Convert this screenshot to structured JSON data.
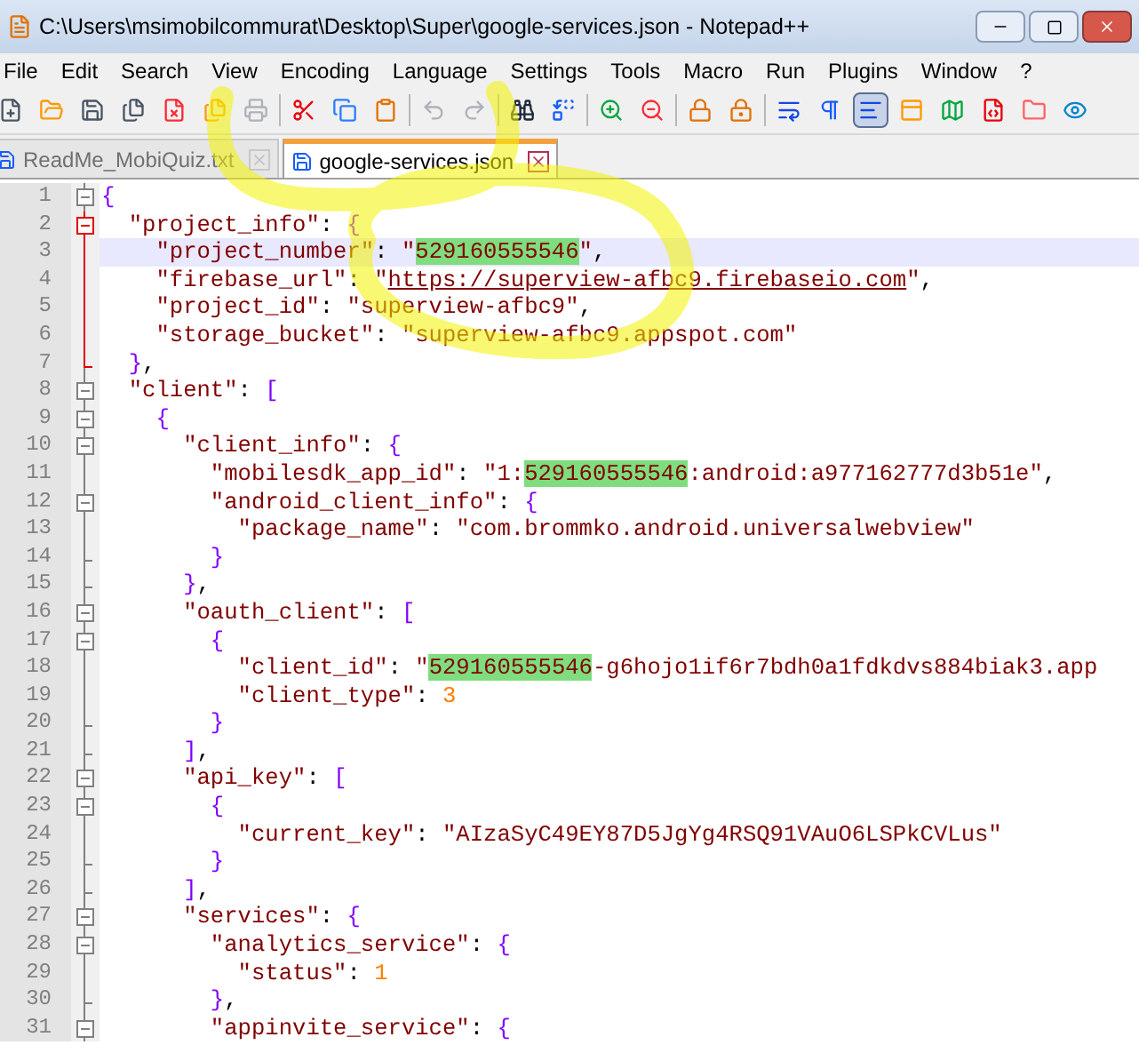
{
  "window": {
    "title": "C:\\Users\\msimobilcommurat\\Desktop\\Super\\google-services.json - Notepad++"
  },
  "menu": [
    "File",
    "Edit",
    "Search",
    "View",
    "Encoding",
    "Language",
    "Settings",
    "Tools",
    "Macro",
    "Run",
    "Plugins",
    "Window",
    "?"
  ],
  "toolbar": [
    {
      "pressed": false,
      "disabled": false
    },
    {
      "pressed": false,
      "disabled": false
    },
    {
      "pressed": false,
      "disabled": false
    },
    {
      "pressed": false,
      "disabled": false
    },
    {
      "pressed": false,
      "disabled": false
    },
    {
      "pressed": false,
      "disabled": false
    },
    {
      "pressed": false,
      "disabled": true
    },
    {
      "pressed": false,
      "disabled": false
    },
    {
      "pressed": false,
      "disabled": false
    },
    {
      "pressed": false,
      "disabled": false
    },
    {
      "pressed": false,
      "disabled": true
    },
    {
      "pressed": false,
      "disabled": true
    },
    {
      "pressed": false,
      "disabled": false
    },
    {
      "pressed": false,
      "disabled": false
    },
    {
      "pressed": false,
      "disabled": false
    },
    {
      "pressed": false,
      "disabled": false
    },
    {
      "pressed": false,
      "disabled": false
    },
    {
      "pressed": false,
      "disabled": false
    },
    {
      "pressed": false,
      "disabled": false
    },
    {
      "pressed": false,
      "disabled": false
    },
    {
      "pressed": true,
      "disabled": false
    },
    {
      "pressed": false,
      "disabled": false
    },
    {
      "pressed": false,
      "disabled": false
    },
    {
      "pressed": false,
      "disabled": false
    },
    {
      "pressed": false,
      "disabled": false
    },
    {
      "pressed": false,
      "disabled": false
    }
  ],
  "tabs": [
    {
      "label": "ReadMe_MobiQuiz.txt",
      "selected": false
    },
    {
      "label": "google-services.json",
      "selected": true
    }
  ],
  "editor": {
    "lines": [
      {
        "number": "1",
        "fold_start": true,
        "fold_end": false,
        "active": false,
        "current": false,
        "tokens": [
          {
            "kind": "brace",
            "text": "{"
          }
        ]
      },
      {
        "number": "2",
        "fold_start": true,
        "fold_end": false,
        "active": true,
        "current": false,
        "tokens": [
          {
            "kind": "key",
            "text": "  \"project_info\""
          },
          {
            "kind": "op",
            "text": ": "
          },
          {
            "kind": "brace",
            "text": "{"
          }
        ]
      },
      {
        "number": "3",
        "fold_start": false,
        "fold_end": false,
        "active": true,
        "current": true,
        "tokens": [
          {
            "kind": "key",
            "text": "    \"project_number\""
          },
          {
            "kind": "op",
            "text": ": "
          },
          {
            "kind": "string",
            "text": "\""
          },
          {
            "kind": "match",
            "text": "529160555546"
          },
          {
            "kind": "string",
            "text": "\""
          },
          {
            "kind": "op",
            "text": ","
          }
        ]
      },
      {
        "number": "4",
        "fold_start": false,
        "fold_end": false,
        "active": true,
        "current": false,
        "tokens": [
          {
            "kind": "key",
            "text": "    \"firebase_url\""
          },
          {
            "kind": "op",
            "text": ": "
          },
          {
            "kind": "string",
            "text": "\""
          },
          {
            "kind": "url",
            "text": "https://superview-afbc9.firebaseio.com"
          },
          {
            "kind": "string",
            "text": "\""
          },
          {
            "kind": "op",
            "text": ","
          }
        ]
      },
      {
        "number": "5",
        "fold_start": false,
        "fold_end": false,
        "active": true,
        "current": false,
        "tokens": [
          {
            "kind": "key",
            "text": "    \"project_id\""
          },
          {
            "kind": "op",
            "text": ": "
          },
          {
            "kind": "string",
            "text": "\"superview-afbc9\""
          },
          {
            "kind": "op",
            "text": ","
          }
        ]
      },
      {
        "number": "6",
        "fold_start": false,
        "fold_end": false,
        "active": true,
        "current": false,
        "tokens": [
          {
            "kind": "key",
            "text": "    \"storage_bucket\""
          },
          {
            "kind": "op",
            "text": ": "
          },
          {
            "kind": "string",
            "text": "\"superview-afbc9.appspot.com\""
          }
        ]
      },
      {
        "number": "7",
        "fold_start": false,
        "fold_end": true,
        "active": true,
        "current": false,
        "tokens": [
          {
            "kind": "brace",
            "text": "  }"
          },
          {
            "kind": "op",
            "text": ","
          }
        ]
      },
      {
        "number": "8",
        "fold_start": true,
        "fold_end": false,
        "active": false,
        "current": false,
        "tokens": [
          {
            "kind": "key",
            "text": "  \"client\""
          },
          {
            "kind": "op",
            "text": ": "
          },
          {
            "kind": "brace",
            "text": "["
          }
        ]
      },
      {
        "number": "9",
        "fold_start": true,
        "fold_end": false,
        "active": false,
        "current": false,
        "tokens": [
          {
            "kind": "brace",
            "text": "    {"
          }
        ]
      },
      {
        "number": "10",
        "fold_start": true,
        "fold_end": false,
        "active": false,
        "current": false,
        "tokens": [
          {
            "kind": "key",
            "text": "      \"client_info\""
          },
          {
            "kind": "op",
            "text": ": "
          },
          {
            "kind": "brace",
            "text": "{"
          }
        ]
      },
      {
        "number": "11",
        "fold_start": false,
        "fold_end": false,
        "active": false,
        "current": false,
        "tokens": [
          {
            "kind": "key",
            "text": "        \"mobilesdk_app_id\""
          },
          {
            "kind": "op",
            "text": ": "
          },
          {
            "kind": "string",
            "text": "\"1:"
          },
          {
            "kind": "match",
            "text": "529160555546"
          },
          {
            "kind": "string",
            "text": ":android:a977162777d3b51e\""
          },
          {
            "kind": "op",
            "text": ","
          }
        ]
      },
      {
        "number": "12",
        "fold_start": true,
        "fold_end": false,
        "active": false,
        "current": false,
        "tokens": [
          {
            "kind": "key",
            "text": "        \"android_client_info\""
          },
          {
            "kind": "op",
            "text": ": "
          },
          {
            "kind": "brace",
            "text": "{"
          }
        ]
      },
      {
        "number": "13",
        "fold_start": false,
        "fold_end": false,
        "active": false,
        "current": false,
        "tokens": [
          {
            "kind": "key",
            "text": "          \"package_name\""
          },
          {
            "kind": "op",
            "text": ": "
          },
          {
            "kind": "string",
            "text": "\"com.brommko.android.universalwebview\""
          }
        ]
      },
      {
        "number": "14",
        "fold_start": false,
        "fold_end": true,
        "active": false,
        "current": false,
        "tokens": [
          {
            "kind": "brace",
            "text": "        }"
          }
        ]
      },
      {
        "number": "15",
        "fold_start": false,
        "fold_end": true,
        "active": false,
        "current": false,
        "tokens": [
          {
            "kind": "brace",
            "text": "      }"
          },
          {
            "kind": "op",
            "text": ","
          }
        ]
      },
      {
        "number": "16",
        "fold_start": true,
        "fold_end": false,
        "active": false,
        "current": false,
        "tokens": [
          {
            "kind": "key",
            "text": "      \"oauth_client\""
          },
          {
            "kind": "op",
            "text": ": "
          },
          {
            "kind": "brace",
            "text": "["
          }
        ]
      },
      {
        "number": "17",
        "fold_start": true,
        "fold_end": false,
        "active": false,
        "current": false,
        "tokens": [
          {
            "kind": "brace",
            "text": "        {"
          }
        ]
      },
      {
        "number": "18",
        "fold_start": false,
        "fold_end": false,
        "active": false,
        "current": false,
        "tokens": [
          {
            "kind": "key",
            "text": "          \"client_id\""
          },
          {
            "kind": "op",
            "text": ": "
          },
          {
            "kind": "string",
            "text": "\""
          },
          {
            "kind": "match",
            "text": "529160555546"
          },
          {
            "kind": "string",
            "text": "-g6hojo1if6r7bdh0a1fdkdvs884biak3.app"
          }
        ]
      },
      {
        "number": "19",
        "fold_start": false,
        "fold_end": false,
        "active": false,
        "current": false,
        "tokens": [
          {
            "kind": "key",
            "text": "          \"client_type\""
          },
          {
            "kind": "op",
            "text": ": "
          },
          {
            "kind": "number",
            "text": "3"
          }
        ]
      },
      {
        "number": "20",
        "fold_start": false,
        "fold_end": true,
        "active": false,
        "current": false,
        "tokens": [
          {
            "kind": "brace",
            "text": "        }"
          }
        ]
      },
      {
        "number": "21",
        "fold_start": false,
        "fold_end": true,
        "active": false,
        "current": false,
        "tokens": [
          {
            "kind": "brace",
            "text": "      ]"
          },
          {
            "kind": "op",
            "text": ","
          }
        ]
      },
      {
        "number": "22",
        "fold_start": true,
        "fold_end": false,
        "active": false,
        "current": false,
        "tokens": [
          {
            "kind": "key",
            "text": "      \"api_key\""
          },
          {
            "kind": "op",
            "text": ": "
          },
          {
            "kind": "brace",
            "text": "["
          }
        ]
      },
      {
        "number": "23",
        "fold_start": true,
        "fold_end": false,
        "active": false,
        "current": false,
        "tokens": [
          {
            "kind": "brace",
            "text": "        {"
          }
        ]
      },
      {
        "number": "24",
        "fold_start": false,
        "fold_end": false,
        "active": false,
        "current": false,
        "tokens": [
          {
            "kind": "key",
            "text": "          \"current_key\""
          },
          {
            "kind": "op",
            "text": ": "
          },
          {
            "kind": "string",
            "text": "\"AIzaSyC49EY87D5JgYg4RSQ91VAuO6LSPkCVLus\""
          }
        ]
      },
      {
        "number": "25",
        "fold_start": false,
        "fold_end": true,
        "active": false,
        "current": false,
        "tokens": [
          {
            "kind": "brace",
            "text": "        }"
          }
        ]
      },
      {
        "number": "26",
        "fold_start": false,
        "fold_end": true,
        "active": false,
        "current": false,
        "tokens": [
          {
            "kind": "brace",
            "text": "      ]"
          },
          {
            "kind": "op",
            "text": ","
          }
        ]
      },
      {
        "number": "27",
        "fold_start": true,
        "fold_end": false,
        "active": false,
        "current": false,
        "tokens": [
          {
            "kind": "key",
            "text": "      \"services\""
          },
          {
            "kind": "op",
            "text": ": "
          },
          {
            "kind": "brace",
            "text": "{"
          }
        ]
      },
      {
        "number": "28",
        "fold_start": true,
        "fold_end": false,
        "active": false,
        "current": false,
        "tokens": [
          {
            "kind": "key",
            "text": "        \"analytics_service\""
          },
          {
            "kind": "op",
            "text": ": "
          },
          {
            "kind": "brace",
            "text": "{"
          }
        ]
      },
      {
        "number": "29",
        "fold_start": false,
        "fold_end": false,
        "active": false,
        "current": false,
        "tokens": [
          {
            "kind": "key",
            "text": "          \"status\""
          },
          {
            "kind": "op",
            "text": ": "
          },
          {
            "kind": "number",
            "text": "1"
          }
        ]
      },
      {
        "number": "30",
        "fold_start": false,
        "fold_end": true,
        "active": false,
        "current": false,
        "tokens": [
          {
            "kind": "brace",
            "text": "        }"
          },
          {
            "kind": "op",
            "text": ","
          }
        ]
      },
      {
        "number": "31",
        "fold_start": true,
        "fold_end": false,
        "active": false,
        "current": false,
        "tokens": [
          {
            "kind": "key",
            "text": "        \"appinvite_service\""
          },
          {
            "kind": "op",
            "text": ": "
          },
          {
            "kind": "brace",
            "text": "{"
          }
        ]
      }
    ]
  }
}
